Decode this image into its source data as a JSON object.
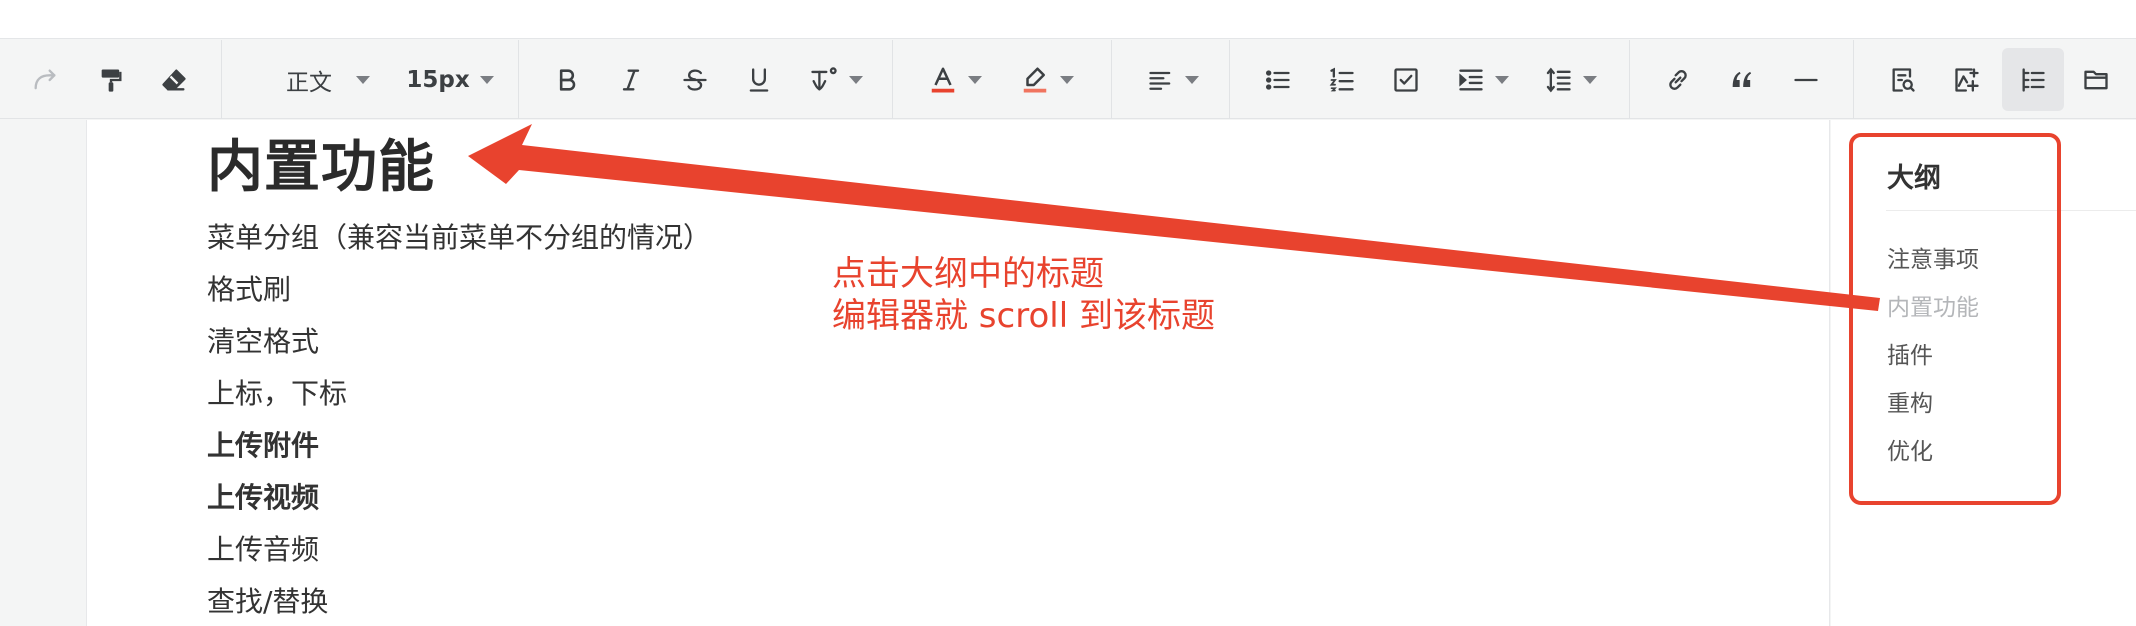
{
  "toolbar": {
    "paragraph_style": "正文",
    "font_size": "15px",
    "buttons": [
      {
        "icon": "redo-icon"
      },
      {
        "icon": "format-painter-icon"
      },
      {
        "icon": "eraser-icon"
      },
      {
        "icon": "bold-icon"
      },
      {
        "icon": "italic-icon"
      },
      {
        "icon": "strikethrough-icon"
      },
      {
        "icon": "underline-icon"
      },
      {
        "icon": "text-script-icon"
      },
      {
        "icon": "font-color-icon",
        "color": "#e8432e"
      },
      {
        "icon": "highlight-icon",
        "color": "#f0745f"
      },
      {
        "icon": "align-left-icon"
      },
      {
        "icon": "bullet-list-icon"
      },
      {
        "icon": "ordered-list-icon"
      },
      {
        "icon": "checkbox-list-icon"
      },
      {
        "icon": "indent-icon"
      },
      {
        "icon": "line-height-icon"
      },
      {
        "icon": "link-icon"
      },
      {
        "icon": "quote-icon"
      },
      {
        "icon": "horizontal-rule-icon"
      },
      {
        "icon": "find-replace-icon"
      },
      {
        "icon": "image-insert-icon"
      },
      {
        "icon": "outline-toggle-icon"
      },
      {
        "icon": "folder-icon"
      }
    ]
  },
  "document": {
    "heading": "内置功能",
    "items": [
      {
        "text": "菜单分组（兼容当前菜单不分组的情况）",
        "bold": false
      },
      {
        "text": "格式刷",
        "bold": false
      },
      {
        "text": "清空格式",
        "bold": false
      },
      {
        "text": "上标，下标",
        "bold": false
      },
      {
        "text": "上传附件",
        "bold": true
      },
      {
        "text": "上传视频",
        "bold": true
      },
      {
        "text": "上传音频",
        "bold": false
      },
      {
        "text": "查找/替换",
        "bold": false
      }
    ]
  },
  "outline": {
    "title": "大纲",
    "items": [
      {
        "label": "注意事项",
        "state": "normal"
      },
      {
        "label": "内置功能",
        "state": "muted"
      },
      {
        "label": "插件",
        "state": "normal"
      },
      {
        "label": "重构",
        "state": "normal"
      },
      {
        "label": "优化",
        "state": "normal"
      }
    ]
  },
  "annotation": {
    "line1": "点击大纲中的标题",
    "line2": "编辑器就 scroll 到该标题",
    "color": "#e8432e"
  }
}
